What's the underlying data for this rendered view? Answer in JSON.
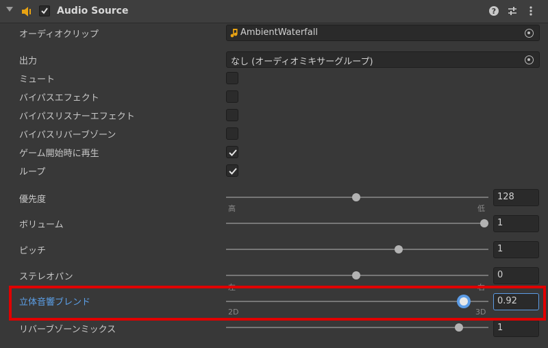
{
  "header": {
    "title": "Audio Source",
    "icons": [
      "fold-arrow-icon",
      "speaker-icon",
      "enable-checkbox",
      "help-icon",
      "preset-icon",
      "menu-icon"
    ]
  },
  "properties": {
    "audio_clip": {
      "label": "オーディオクリップ",
      "value": "AmbientWaterfall",
      "icon": "music-note-icon"
    },
    "output": {
      "label": "出力",
      "value": "なし (オーディオミキサーグループ)"
    },
    "mute": {
      "label": "ミュート",
      "checked": false
    },
    "bypass_effects": {
      "label": "バイパスエフェクト",
      "checked": false
    },
    "bypass_listener_effects": {
      "label": "バイパスリスナーエフェクト",
      "checked": false
    },
    "bypass_reverb_zones": {
      "label": "バイパスリバーブゾーン",
      "checked": false
    },
    "play_on_awake": {
      "label": "ゲーム開始時に再生",
      "checked": true
    },
    "loop": {
      "label": "ループ",
      "checked": true
    },
    "priority": {
      "label": "優先度",
      "value": "128",
      "min_label": "高",
      "max_label": "低",
      "fraction": 0.5
    },
    "volume": {
      "label": "ボリューム",
      "value": "1",
      "fraction": 1.0
    },
    "pitch": {
      "label": "ピッチ",
      "value": "1",
      "fraction": 0.667
    },
    "stereo_pan": {
      "label": "ステレオパン",
      "value": "0",
      "min_label": "左",
      "max_label": "右",
      "fraction": 0.5
    },
    "spatial_blend": {
      "label": "立体音響ブレンド",
      "value": "0.92",
      "min_label": "2D",
      "max_label": "3D",
      "fraction": 0.92
    },
    "reverb_zone_mix": {
      "label": "リバーブゾーンミックス",
      "value": "1",
      "fraction": 0.9
    }
  },
  "colors": {
    "highlight_border": "#e00000",
    "active_label": "#5ca0e8",
    "focus_border": "#5c9ce6"
  }
}
